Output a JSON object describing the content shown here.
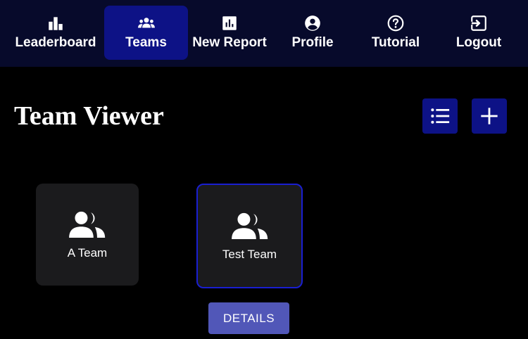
{
  "nav": {
    "items": [
      {
        "label": "Leaderboard",
        "icon": "bar-chart-icon",
        "active": false
      },
      {
        "label": "Teams",
        "icon": "groups-icon",
        "active": true
      },
      {
        "label": "New Report",
        "icon": "report-icon",
        "active": false
      },
      {
        "label": "Profile",
        "icon": "account-circle-icon",
        "active": false
      },
      {
        "label": "Tutorial",
        "icon": "help-circle-icon",
        "active": false
      },
      {
        "label": "Logout",
        "icon": "logout-icon",
        "active": false
      }
    ]
  },
  "page": {
    "title": "Team Viewer"
  },
  "toolbar": {
    "list_icon": "list-icon",
    "add_icon": "plus-icon"
  },
  "teams": [
    {
      "name": "A Team",
      "icon": "people-icon",
      "selected": false
    },
    {
      "name": "Test Team",
      "icon": "people-icon",
      "selected": true
    }
  ],
  "details_button": {
    "label": "DETAILS"
  },
  "colors": {
    "nav_background": "#070a2b",
    "active_nav": "#0d1286",
    "page_background": "#000000",
    "card_background": "#1b1b1d",
    "selected_border": "#1a1fd1",
    "details_button": "#5157b8"
  }
}
